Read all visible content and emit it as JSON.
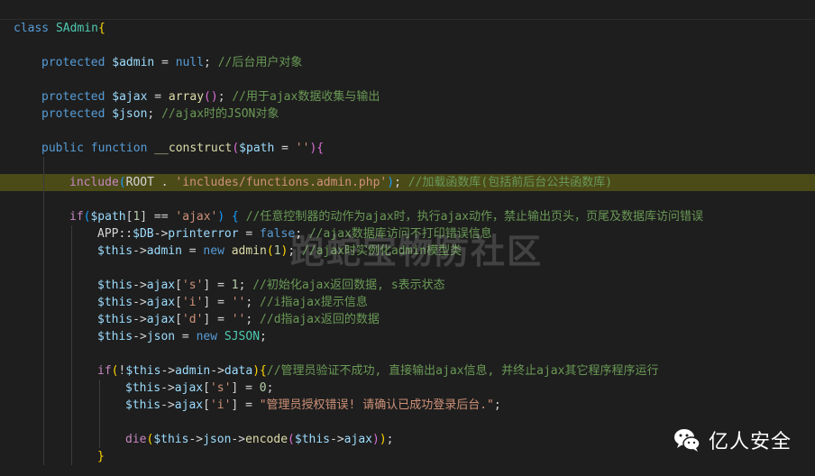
{
  "editor": {
    "lines": [
      {
        "indent": 0,
        "tokens": [
          [
            "kw",
            "class "
          ],
          [
            "cls",
            "SAdmin"
          ],
          [
            "brace",
            "{"
          ]
        ]
      },
      {
        "indent": 0,
        "tokens": []
      },
      {
        "indent": 1,
        "tokens": [
          [
            "kw",
            "protected "
          ],
          [
            "var",
            "$admin"
          ],
          [
            "op",
            " = "
          ],
          [
            "kw",
            "null"
          ],
          [
            "op",
            "; "
          ],
          [
            "cmt",
            "//后台用户对象"
          ]
        ]
      },
      {
        "indent": 1,
        "tokens": []
      },
      {
        "indent": 1,
        "tokens": [
          [
            "kw",
            "protected "
          ],
          [
            "var",
            "$ajax"
          ],
          [
            "op",
            " = "
          ],
          [
            "fn",
            "array"
          ],
          [
            "brace2",
            "()"
          ],
          [
            "op",
            "; "
          ],
          [
            "cmt",
            "//用于ajax数据收集与输出"
          ]
        ]
      },
      {
        "indent": 1,
        "tokens": [
          [
            "kw",
            "protected "
          ],
          [
            "var",
            "$json"
          ],
          [
            "op",
            "; "
          ],
          [
            "cmt",
            "//ajax时的JSON对象"
          ]
        ]
      },
      {
        "indent": 1,
        "tokens": []
      },
      {
        "indent": 1,
        "tokens": [
          [
            "kw",
            "public "
          ],
          [
            "kw",
            "function "
          ],
          [
            "fn",
            "__construct"
          ],
          [
            "brace2",
            "("
          ],
          [
            "var",
            "$path"
          ],
          [
            "op",
            " = "
          ],
          [
            "str",
            "''"
          ],
          [
            "brace2",
            ")"
          ],
          [
            "brace2",
            "{"
          ]
        ]
      },
      {
        "indent": 2,
        "tokens": []
      },
      {
        "indent": 2,
        "tokens": [
          [
            "ctrl",
            "include"
          ],
          [
            "brace3",
            "("
          ],
          [
            "op",
            "ROOT . "
          ],
          [
            "str",
            "'includes/functions.admin.php'"
          ],
          [
            "brace3",
            ")"
          ],
          [
            "op",
            "; "
          ],
          [
            "cmt",
            "//加载函数库(包括前后台公共函数库)"
          ]
        ],
        "highlight": true
      },
      {
        "indent": 2,
        "tokens": []
      },
      {
        "indent": 2,
        "tokens": [
          [
            "ctrl",
            "if"
          ],
          [
            "brace3",
            "("
          ],
          [
            "var",
            "$path"
          ],
          [
            "op",
            "["
          ],
          [
            "num",
            "1"
          ],
          [
            "op",
            "] == "
          ],
          [
            "str",
            "'ajax'"
          ],
          [
            "brace3",
            ")"
          ],
          [
            "op",
            " "
          ],
          [
            "brace3",
            "{"
          ],
          [
            "op",
            " "
          ],
          [
            "cmt",
            "//任意控制器的动作为ajax时，执行ajax动作，禁止输出页头，页尾及数据库访问错误"
          ]
        ]
      },
      {
        "indent": 3,
        "tokens": [
          [
            "op",
            "APP::"
          ],
          [
            "var",
            "$DB"
          ],
          [
            "op",
            "->"
          ],
          [
            "var",
            "printerror"
          ],
          [
            "op",
            " = "
          ],
          [
            "kw",
            "false"
          ],
          [
            "op",
            "; "
          ],
          [
            "cmt",
            "//ajax数据库访问不打印错误信息"
          ]
        ]
      },
      {
        "indent": 3,
        "tokens": [
          [
            "var",
            "$this"
          ],
          [
            "op",
            "->"
          ],
          [
            "var",
            "admin"
          ],
          [
            "op",
            " = "
          ],
          [
            "kw",
            "new "
          ],
          [
            "fn",
            "admin"
          ],
          [
            "brace",
            "("
          ],
          [
            "num",
            "1"
          ],
          [
            "brace",
            ")"
          ],
          [
            "op",
            "; "
          ],
          [
            "cmt",
            "//ajax时实例化admin模型类"
          ]
        ]
      },
      {
        "indent": 3,
        "tokens": []
      },
      {
        "indent": 3,
        "tokens": [
          [
            "var",
            "$this"
          ],
          [
            "op",
            "->"
          ],
          [
            "var",
            "ajax"
          ],
          [
            "op",
            "["
          ],
          [
            "str",
            "'s'"
          ],
          [
            "op",
            "] = "
          ],
          [
            "num",
            "1"
          ],
          [
            "op",
            "; "
          ],
          [
            "cmt",
            "//初始化ajax返回数据, s表示状态"
          ]
        ]
      },
      {
        "indent": 3,
        "tokens": [
          [
            "var",
            "$this"
          ],
          [
            "op",
            "->"
          ],
          [
            "var",
            "ajax"
          ],
          [
            "op",
            "["
          ],
          [
            "str",
            "'i'"
          ],
          [
            "op",
            "] = "
          ],
          [
            "str",
            "''"
          ],
          [
            "op",
            "; "
          ],
          [
            "cmt",
            "//i指ajax提示信息"
          ]
        ]
      },
      {
        "indent": 3,
        "tokens": [
          [
            "var",
            "$this"
          ],
          [
            "op",
            "->"
          ],
          [
            "var",
            "ajax"
          ],
          [
            "op",
            "["
          ],
          [
            "str",
            "'d'"
          ],
          [
            "op",
            "] = "
          ],
          [
            "str",
            "''"
          ],
          [
            "op",
            "; "
          ],
          [
            "cmt",
            "//d指ajax返回的数据"
          ]
        ]
      },
      {
        "indent": 3,
        "tokens": [
          [
            "var",
            "$this"
          ],
          [
            "op",
            "->"
          ],
          [
            "var",
            "json"
          ],
          [
            "op",
            " = "
          ],
          [
            "kw",
            "new "
          ],
          [
            "cls",
            "SJSON"
          ],
          [
            "op",
            ";"
          ]
        ]
      },
      {
        "indent": 3,
        "tokens": []
      },
      {
        "indent": 3,
        "tokens": [
          [
            "ctrl",
            "if"
          ],
          [
            "brace",
            "("
          ],
          [
            "op",
            "!"
          ],
          [
            "var",
            "$this"
          ],
          [
            "op",
            "->"
          ],
          [
            "var",
            "admin"
          ],
          [
            "op",
            "->"
          ],
          [
            "var",
            "data"
          ],
          [
            "brace",
            ")"
          ],
          [
            "brace",
            "{"
          ],
          [
            "cmt",
            "//管理员验证不成功, 直接输出ajax信息, 并终止ajax其它程序程序运行"
          ]
        ]
      },
      {
        "indent": 4,
        "tokens": [
          [
            "var",
            "$this"
          ],
          [
            "op",
            "->"
          ],
          [
            "var",
            "ajax"
          ],
          [
            "op",
            "["
          ],
          [
            "str",
            "'s'"
          ],
          [
            "op",
            "] = "
          ],
          [
            "num",
            "0"
          ],
          [
            "op",
            ";"
          ]
        ]
      },
      {
        "indent": 4,
        "tokens": [
          [
            "var",
            "$this"
          ],
          [
            "op",
            "->"
          ],
          [
            "var",
            "ajax"
          ],
          [
            "op",
            "["
          ],
          [
            "str",
            "'i'"
          ],
          [
            "op",
            "] = "
          ],
          [
            "str",
            "\"管理员授权错误! 请确认已成功登录后台.\""
          ],
          [
            "op",
            ";"
          ]
        ]
      },
      {
        "indent": 4,
        "tokens": []
      },
      {
        "indent": 4,
        "tokens": [
          [
            "ctrl",
            "die"
          ],
          [
            "brace",
            "("
          ],
          [
            "var",
            "$this"
          ],
          [
            "op",
            "->"
          ],
          [
            "var",
            "json"
          ],
          [
            "op",
            "->"
          ],
          [
            "fn",
            "encode"
          ],
          [
            "brace2",
            "("
          ],
          [
            "var",
            "$this"
          ],
          [
            "op",
            "->"
          ],
          [
            "var",
            "ajax"
          ],
          [
            "brace2",
            ")"
          ],
          [
            "brace",
            ")"
          ],
          [
            "op",
            ";"
          ]
        ]
      },
      {
        "indent": 3,
        "tokens": [
          [
            "brace",
            "}"
          ]
        ]
      }
    ]
  },
  "watermark": {
    "text": "跑蛇宝物防社区"
  },
  "brand": {
    "name": "亿人安全",
    "icon": "wechat-icon"
  }
}
